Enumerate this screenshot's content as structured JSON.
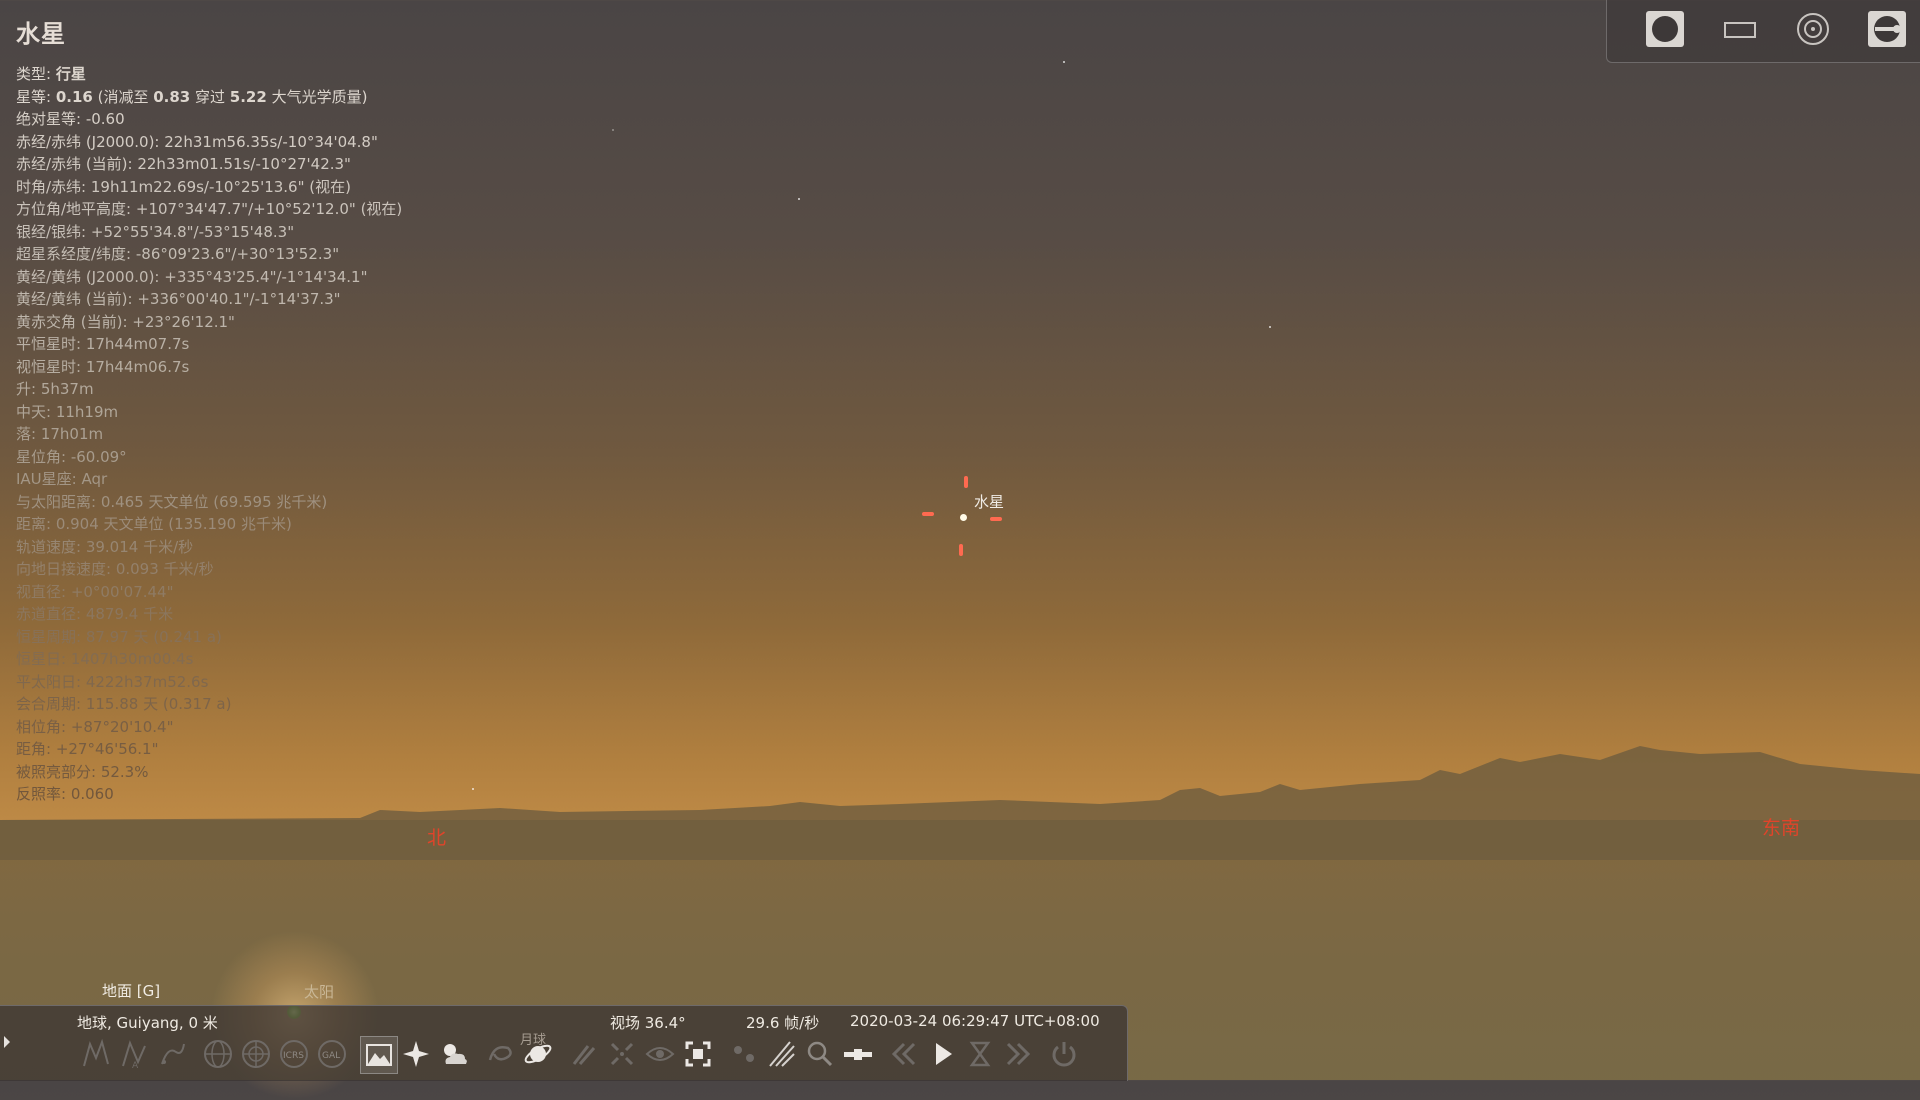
{
  "object": {
    "name": "水星",
    "info_lines": [
      {
        "label": "类型: ",
        "value": "行星",
        "rest": ""
      },
      {
        "label": "星等: ",
        "value": "0.16",
        "rest": " (消减至 ",
        "value2": "0.83",
        "rest2": " 穿过 ",
        "value3": "5.22",
        "rest3": " 大气光学质量)"
      },
      {
        "label": "",
        "value": "",
        "rest": "绝对星等: -0.60"
      },
      {
        "label": "",
        "value": "",
        "rest": "赤经/赤纬 (J2000.0): 22h31m56.35s/-10°34'04.8\""
      },
      {
        "label": "",
        "value": "",
        "rest": "赤经/赤纬 (当前): 22h33m01.51s/-10°27'42.3\""
      },
      {
        "label": "",
        "value": "",
        "rest": "时角/赤纬: 19h11m22.69s/-10°25'13.6\" (视在)"
      },
      {
        "label": "",
        "value": "",
        "rest": "方位角/地平高度: +107°34'47.7\"/+10°52'12.0\" (视在)"
      },
      {
        "label": "",
        "value": "",
        "rest": "银经/银纬: +52°55'34.8\"/-53°15'48.3\""
      },
      {
        "label": "",
        "value": "",
        "rest": "超星系经度/纬度: -86°09'23.6\"/+30°13'52.3\""
      },
      {
        "label": "",
        "value": "",
        "rest": "黄经/黄纬 (J2000.0): +335°43'25.4\"/-1°14'34.1\""
      },
      {
        "label": "",
        "value": "",
        "rest": "黄经/黄纬 (当前): +336°00'40.1\"/-1°14'37.3\""
      },
      {
        "label": "",
        "value": "",
        "rest": "黄赤交角 (当前): +23°26'12.1\""
      },
      {
        "label": "",
        "value": "",
        "rest": "平恒星时: 17h44m07.7s"
      },
      {
        "label": "",
        "value": "",
        "rest": "视恒星时: 17h44m06.7s"
      },
      {
        "label": "",
        "value": "",
        "rest": "升: 5h37m"
      },
      {
        "label": "",
        "value": "",
        "rest": "中天: 11h19m"
      },
      {
        "label": "",
        "value": "",
        "rest": "落: 17h01m"
      },
      {
        "label": "",
        "value": "",
        "rest": "星位角: -60.09°"
      },
      {
        "label": "",
        "value": "",
        "rest": "IAU星座: Aqr"
      },
      {
        "label": "",
        "value": "",
        "rest": "与太阳距离: 0.465 天文单位 (69.595 兆千米)"
      },
      {
        "label": "",
        "value": "",
        "rest": "距离: 0.904 天文单位 (135.190 兆千米)"
      },
      {
        "label": "",
        "value": "",
        "rest": "轨道速度: 39.014 千米/秒"
      },
      {
        "label": "",
        "value": "",
        "rest": "向地日接速度: 0.093 千米/秒"
      },
      {
        "label": "",
        "value": "",
        "rest": "视直径: +0°00'07.44\""
      },
      {
        "label": "",
        "value": "",
        "rest": "赤道直径: 4879.4 千米"
      },
      {
        "label": "",
        "value": "",
        "rest": "恒星周期: 87.97 天 (0.241 a)"
      },
      {
        "label": "",
        "value": "",
        "rest": "恒星日: 1407h30m00.4s"
      },
      {
        "label": "",
        "value": "",
        "rest": "平太阳日: 4222h37m52.6s"
      },
      {
        "label": "",
        "value": "",
        "rest": "会合周期: 115.88 天 (0.317 a)"
      },
      {
        "label": "",
        "value": "",
        "rest": "相位角: +87°20'10.4\""
      },
      {
        "label": "",
        "value": "",
        "rest": "距角: +27°46'56.1\""
      },
      {
        "label": "",
        "value": "",
        "rest": "被照亮部分: 52.3%"
      },
      {
        "label": "",
        "value": "",
        "rest": "反照率: 0.060"
      }
    ],
    "line_colors": [
      "#ddd6ce",
      "#ddd6ce",
      "#d6cfc7",
      "#d3ccc4",
      "#d0c9c1",
      "#cdc6be",
      "#cac3bb",
      "#c7c0b8",
      "#c4bdb4",
      "#c2bab1",
      "#bfb7ad",
      "#bcb4aa",
      "#b9b0a5",
      "#b6ada1",
      "#b3a99c",
      "#afa597",
      "#aba092",
      "#a79b8c",
      "#a39686",
      "#9f9180",
      "#9b8b79",
      "#978672",
      "#93806b",
      "#8f7b64",
      "#8b765e",
      "#877158",
      "#836c52",
      "#80684d",
      "#7d6449",
      "#7a6045",
      "#775d42",
      "#745a3f",
      "#72573c"
    ]
  },
  "sky": {
    "target_label": "水星",
    "direction_labels": {
      "north": "北",
      "southeast": "东南"
    }
  },
  "bottom": {
    "ground_label": "地面 [G]",
    "sun_label": "太阳",
    "location": "地球, Guiyang, 0 米",
    "fov": "视场 36.4°",
    "fps": "29.6 帧/秒",
    "datetime": "2020-03-24 06:29:47 UTC+08:00",
    "moon_tooltip": "月球"
  },
  "colors": {
    "accent_marker": "#ff6a50",
    "direction_text": "#e0442a"
  }
}
